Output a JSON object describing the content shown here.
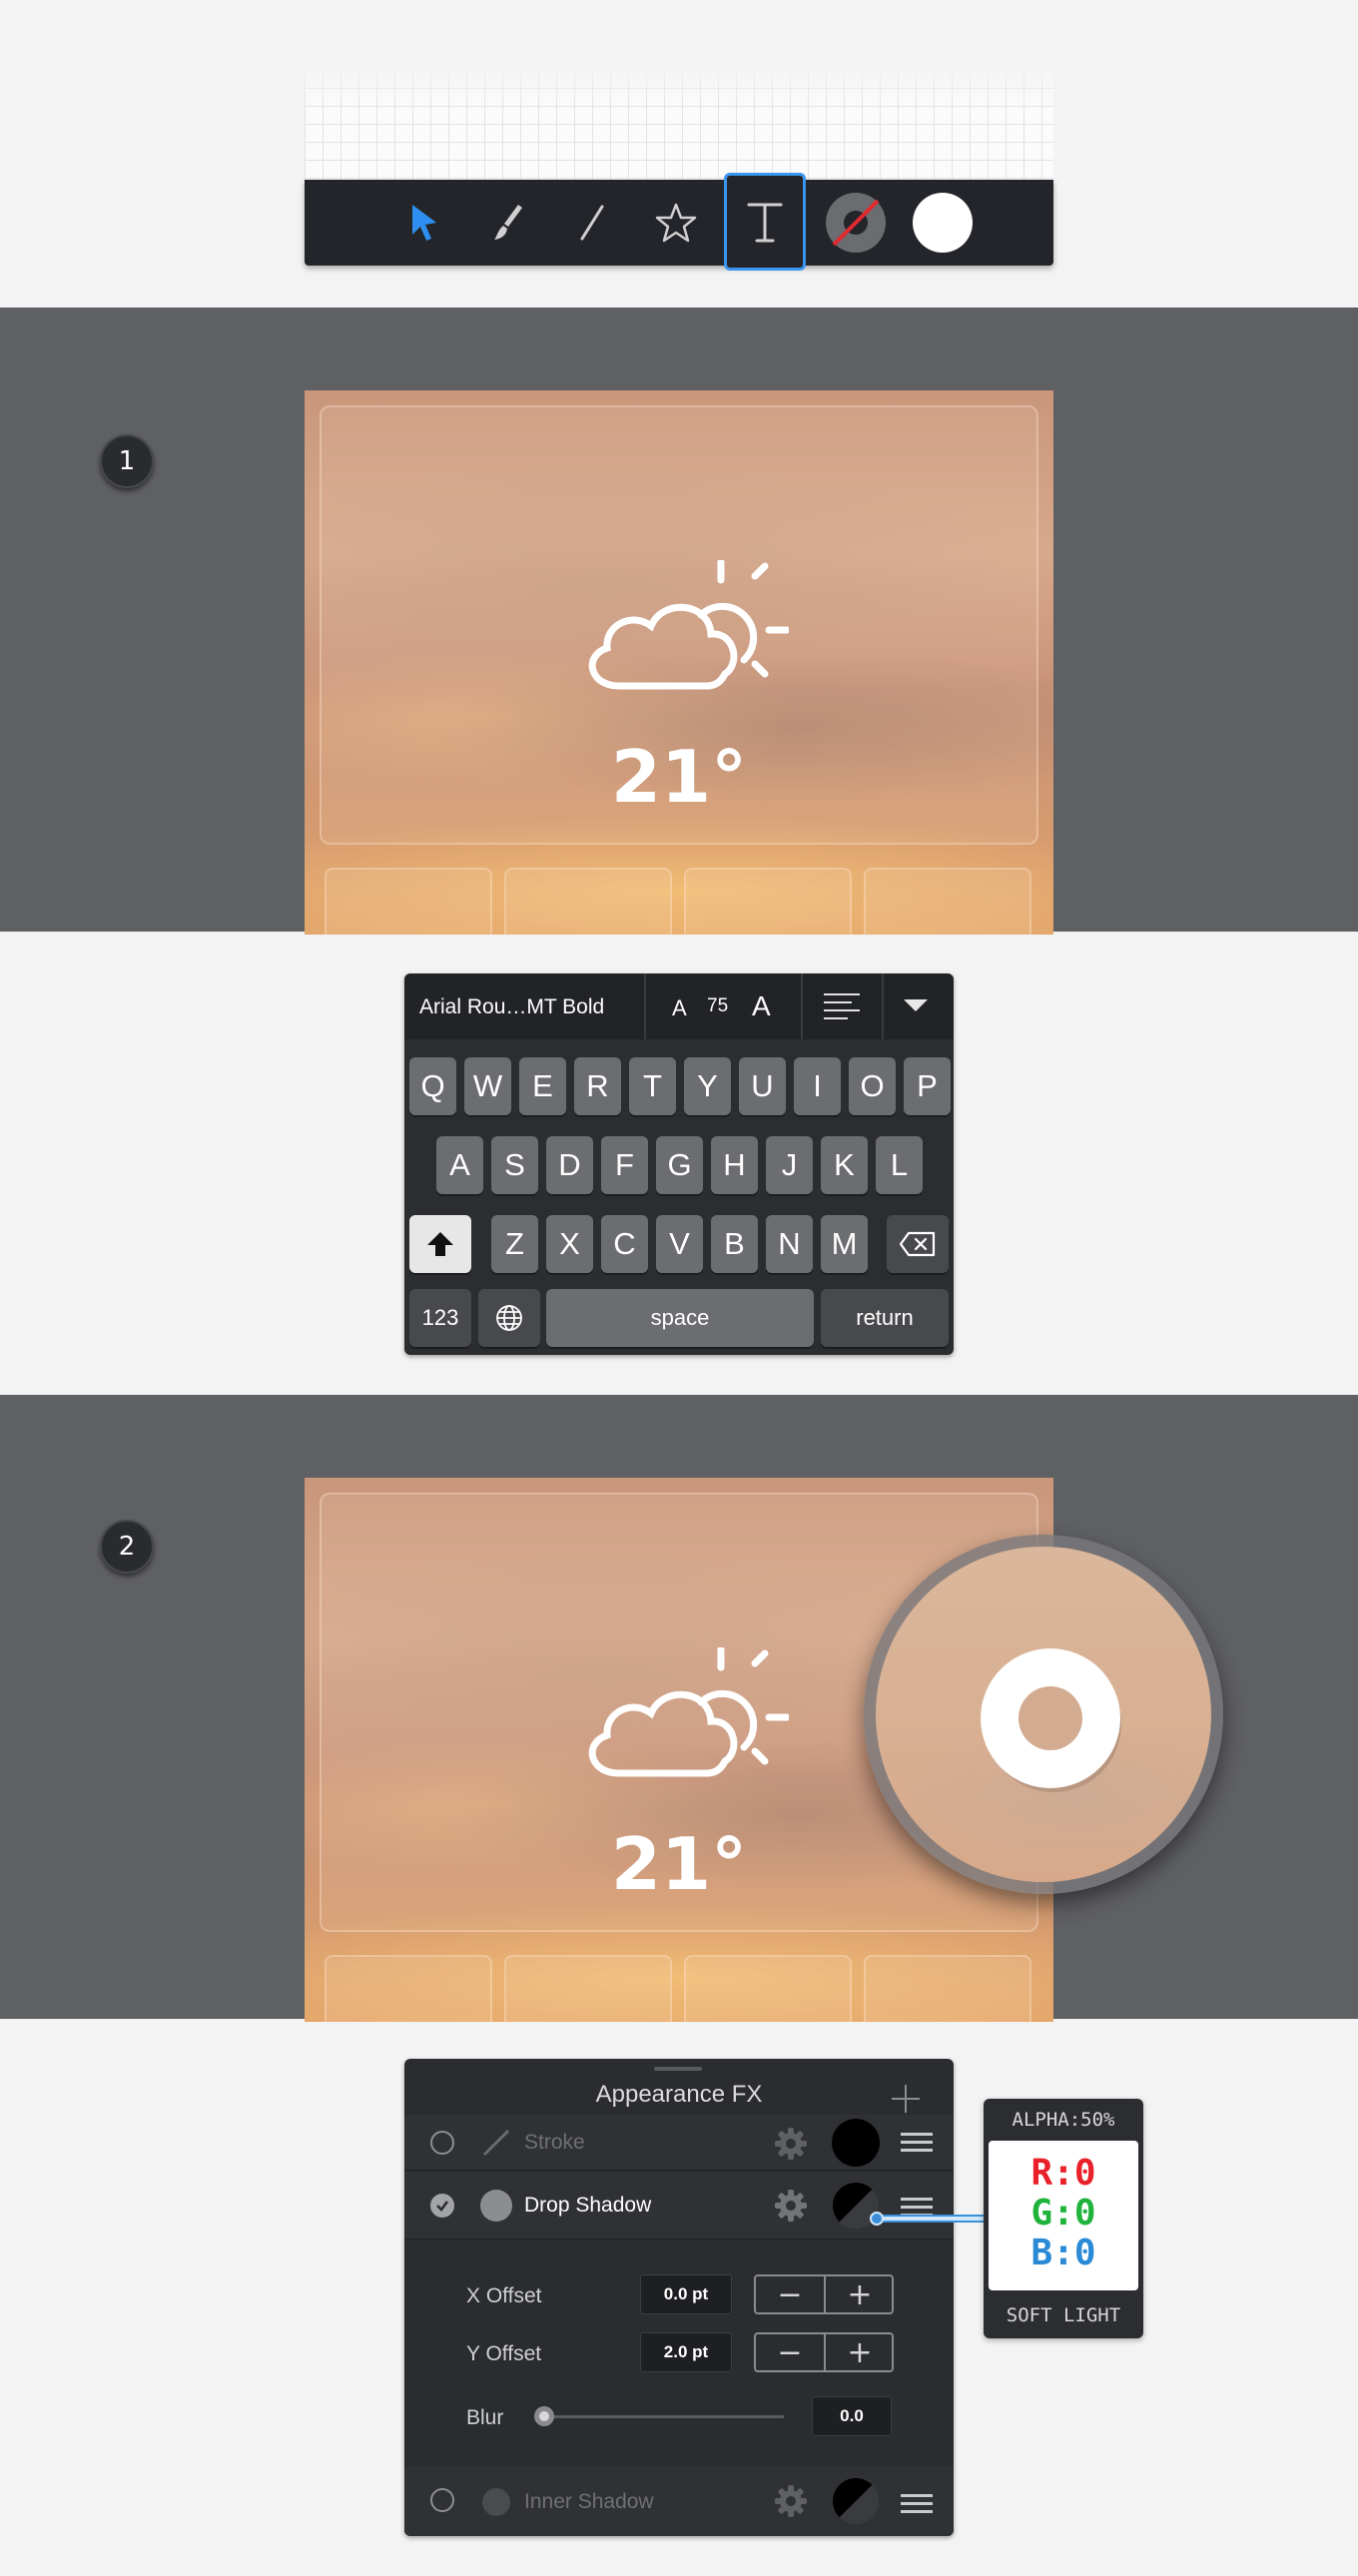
{
  "toolbar": {
    "tools": [
      "select-arrow-icon",
      "brush-icon",
      "line-icon",
      "star-icon",
      "text-icon",
      "stroke-color-icon",
      "fill-color-icon"
    ],
    "selected": "text-icon",
    "accent": "#2f8ff0"
  },
  "step1": {
    "number": "1",
    "widget": {
      "temperature": "21°",
      "icon": "partly-cloudy-icon"
    }
  },
  "keyboard": {
    "font_name": "Arial Rou…MT Bold",
    "size_small_a": "A",
    "size_value": "75",
    "size_large_a": "A",
    "row1": [
      "Q",
      "W",
      "E",
      "R",
      "T",
      "Y",
      "U",
      "I",
      "O",
      "P"
    ],
    "row2": [
      "A",
      "S",
      "D",
      "F",
      "G",
      "H",
      "J",
      "K",
      "L"
    ],
    "row3": [
      "Z",
      "X",
      "C",
      "V",
      "B",
      "N",
      "M"
    ],
    "numbers_key": "123",
    "space_key": "space",
    "return_key": "return"
  },
  "step2": {
    "number": "2",
    "widget": {
      "temperature": "21°",
      "icon": "partly-cloudy-icon"
    }
  },
  "appearance": {
    "title": "Appearance FX",
    "effects": [
      {
        "label": "Stroke",
        "enabled": false
      },
      {
        "label": "Drop Shadow",
        "enabled": true
      },
      {
        "label": "Inner Shadow",
        "enabled": false
      }
    ],
    "x_offset_label": "X Offset",
    "x_offset_value": "0.0 pt",
    "y_offset_label": "Y Offset",
    "y_offset_value": "2.0 pt",
    "blur_label": "Blur",
    "blur_value": "0.0",
    "blur_level": 0
  },
  "color_badge": {
    "alpha": "ALPHA:50%",
    "r": "R:0",
    "g": "G:0",
    "b": "B:0",
    "blend": "SOFT LIGHT",
    "r_color": "#e8212b",
    "g_color": "#1fb33c",
    "b_color": "#2a8ad6"
  }
}
